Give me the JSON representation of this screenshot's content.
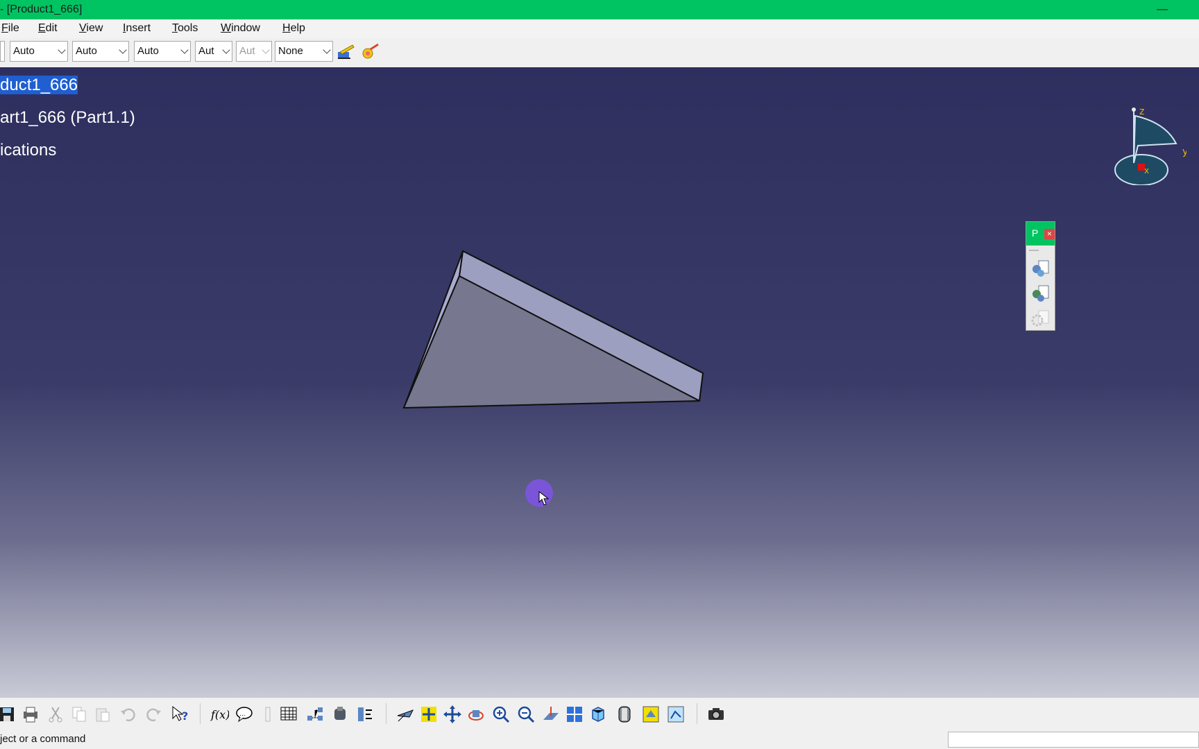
{
  "window": {
    "title": "- [Product1_666]",
    "minimize_label": "—"
  },
  "menu": [
    "File",
    "Edit",
    "View",
    "Insert",
    "Tools",
    "Window",
    "Help"
  ],
  "graphic_properties": {
    "combos": [
      {
        "value": "Auto",
        "enabled": true
      },
      {
        "value": "Auto",
        "enabled": true
      },
      {
        "value": "Auto",
        "enabled": true
      },
      {
        "value": "Aut",
        "enabled": true
      },
      {
        "value": "Aut",
        "enabled": false
      },
      {
        "value": "None",
        "enabled": true
      }
    ],
    "icons": [
      "painter-brush-icon",
      "bulb-brush-icon"
    ]
  },
  "tree": {
    "root": "duct1_666",
    "child": "art1_666 (Part1.1)",
    "applications": "ications"
  },
  "compass": {
    "z_label": "z",
    "y_label": "y",
    "x_label": "x"
  },
  "floating_toolbar": {
    "title_letter": "P",
    "close_label": "×",
    "icons": [
      "product-icon",
      "part-icon",
      "gear-disabled-icon"
    ]
  },
  "standard_toolbar": {
    "icons": [
      "save-icon",
      "print-icon",
      "cut-icon",
      "copy-icon",
      "paste-icon",
      "undo-icon",
      "redo-icon",
      "whats-this-icon",
      "formula-icon",
      "comment-icon",
      "measure-icon",
      "table-icon",
      "tree-icon",
      "assembly-icon",
      "tools-icon",
      "fly-mode-icon",
      "fit-all-icon",
      "pan-icon",
      "rotate-icon",
      "zoom-in-icon",
      "zoom-out-icon",
      "normal-view-icon",
      "multi-view-icon",
      "iso-view-icon",
      "render-style-icon",
      "hide-show-icon",
      "swap-space-icon",
      "camera-icon"
    ]
  },
  "status": {
    "message": "ject or a command",
    "command_input": ""
  },
  "colors": {
    "title_bar": "#00c462",
    "viewport_top": "#2e2f5e",
    "viewport_bottom": "#c9cad6",
    "selection": "#1f5fd1",
    "part_face": "#777892"
  }
}
